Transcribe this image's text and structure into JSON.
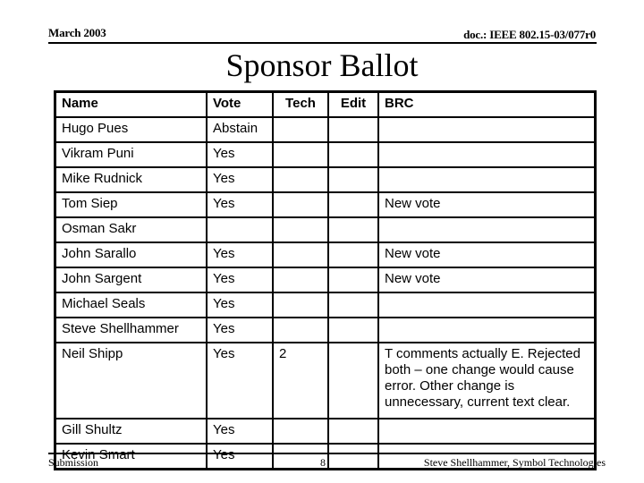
{
  "header": {
    "date": "March 2003",
    "doc_id": "doc.: IEEE 802.15-03/077r0"
  },
  "title": "Sponsor Ballot",
  "table": {
    "columns": [
      "Name",
      "Vote",
      "Tech",
      "Edit",
      "BRC"
    ],
    "rows": [
      {
        "name": "Hugo Pues",
        "vote": "Abstain",
        "tech": "",
        "edit": "",
        "brc": ""
      },
      {
        "name": "Vikram Puni",
        "vote": "Yes",
        "tech": "",
        "edit": "",
        "brc": ""
      },
      {
        "name": "Mike Rudnick",
        "vote": "Yes",
        "tech": "",
        "edit": "",
        "brc": ""
      },
      {
        "name": "Tom Siep",
        "vote": "Yes",
        "tech": "",
        "edit": "",
        "brc": "New vote"
      },
      {
        "name": "Osman Sakr",
        "vote": "",
        "tech": "",
        "edit": "",
        "brc": ""
      },
      {
        "name": "John Sarallo",
        "vote": "Yes",
        "tech": "",
        "edit": "",
        "brc": "New vote"
      },
      {
        "name": "John Sargent",
        "vote": "Yes",
        "tech": "",
        "edit": "",
        "brc": "New vote"
      },
      {
        "name": "Michael Seals",
        "vote": "Yes",
        "tech": "",
        "edit": "",
        "brc": ""
      },
      {
        "name": "Steve Shellhammer",
        "vote": "Yes",
        "tech": "",
        "edit": "",
        "brc": ""
      },
      {
        "name": "Neil Shipp",
        "vote": "Yes",
        "tech": "2",
        "edit": "",
        "brc": "T comments actually E. Rejected both – one change would cause error.  Other change is unnecessary, current text clear."
      },
      {
        "name": "Gill Shultz",
        "vote": "Yes",
        "tech": "",
        "edit": "",
        "brc": ""
      },
      {
        "name": "Kevin Smart",
        "vote": "Yes",
        "tech": "",
        "edit": "",
        "brc": ""
      }
    ]
  },
  "footer": {
    "left": "Submission",
    "page": "8",
    "author": "Steve Shellhammer, Symbol Technologies"
  }
}
